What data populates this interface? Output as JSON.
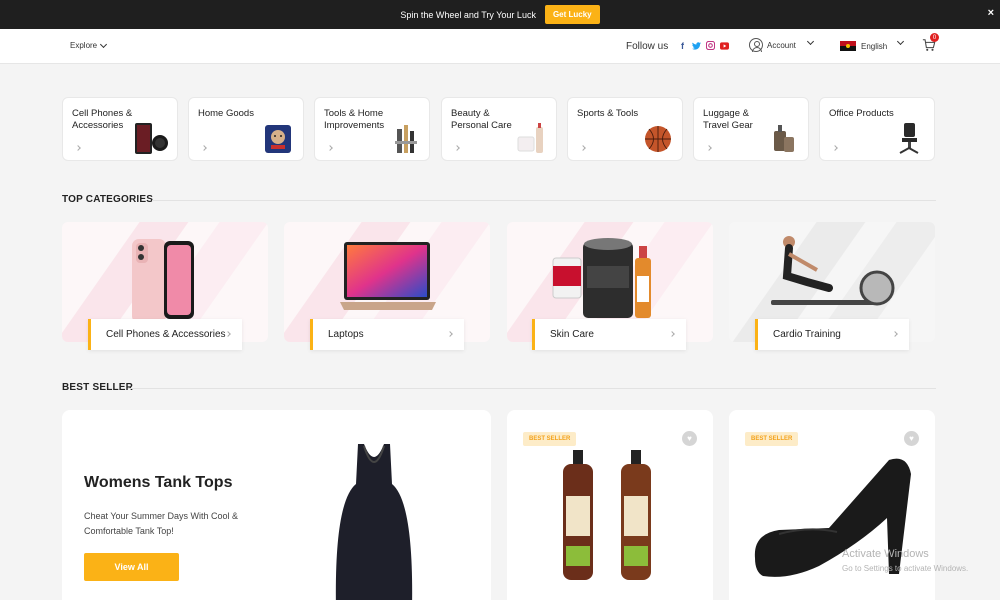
{
  "promo": {
    "text": "Spin the Wheel and Try Your Luck",
    "button": "Get Lucky",
    "close": "×"
  },
  "header": {
    "explore": "Explore",
    "follow": "Follow us",
    "social": [
      {
        "name": "facebook-icon",
        "glyph": "f",
        "color": "#3b5998"
      },
      {
        "name": "twitter-icon",
        "glyph": "t",
        "color": "#1da1f2"
      },
      {
        "name": "instagram-icon",
        "glyph": "◎",
        "color": "#c13584"
      },
      {
        "name": "youtube-icon",
        "glyph": "▶",
        "color": "#e02020"
      }
    ],
    "account": "Account",
    "language": "English",
    "cart_count": "0"
  },
  "categories": [
    {
      "label": "Cell Phones & Accessories"
    },
    {
      "label": "Home Goods"
    },
    {
      "label": "Tools & Home Improvements"
    },
    {
      "label": "Beauty & Personal Care"
    },
    {
      "label": "Sports & Tools"
    },
    {
      "label": "Luggage & Travel Gear"
    },
    {
      "label": "Office Products"
    }
  ],
  "top_categories": {
    "title": "TOP CATEGORIES",
    "items": [
      {
        "label": "Cell Phones & Accessories"
      },
      {
        "label": "Laptops"
      },
      {
        "label": "Skin Care"
      },
      {
        "label": "Cardio Training"
      }
    ]
  },
  "best_seller": {
    "title": "BEST SELLER",
    "feature": {
      "title": "Womens Tank Tops",
      "subtitle": "Cheat Your Summer Days With Cool & Comfortable Tank Top!",
      "button": "View All"
    },
    "badge": "BEST SELLER"
  },
  "watermark": {
    "line1": "Activate Windows",
    "line2": "Go to Settings to activate Windows."
  },
  "colors": {
    "accent": "#fbb216",
    "badge_text": "#f3a21b",
    "topbar": "#1f1f1f"
  }
}
